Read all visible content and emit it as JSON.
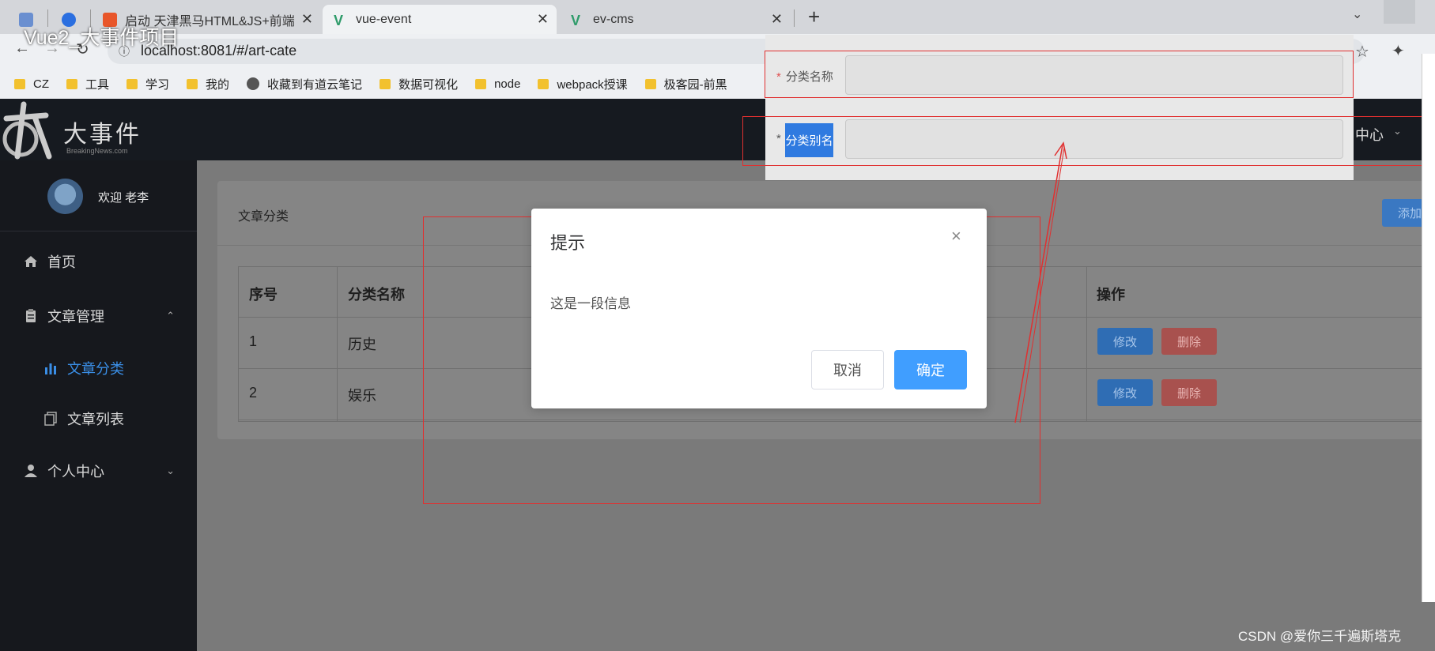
{
  "overlay_title": "Vue2_大事件项目",
  "browser": {
    "tabs": [
      {
        "label": ""
      },
      {
        "label": ""
      },
      {
        "label": "启动 天津黑马HTML&JS+前端"
      },
      {
        "label": "vue-event"
      },
      {
        "label": "ev-cms"
      }
    ],
    "new_tab": "+",
    "url": "localhost:8081/#/art-cate",
    "bookmarks": [
      "CZ",
      "工具",
      "学习",
      "我的",
      "收藏到有道云笔记",
      "数据可视化",
      "node",
      "webpack授课",
      "极客园-前黑"
    ]
  },
  "app": {
    "logo_title": "大事件",
    "logo_sub": "BreakingNews.com",
    "header_right": "中心",
    "welcome": "欢迎 老李",
    "menu": [
      {
        "label": "首页"
      },
      {
        "label": "文章管理"
      },
      {
        "label": "文章分类"
      },
      {
        "label": "文章列表"
      },
      {
        "label": "个人中心"
      }
    ]
  },
  "card": {
    "title": "文章分类",
    "add_button": "添加",
    "columns": [
      "序号",
      "分类名称",
      "操作"
    ],
    "rows": [
      {
        "index": "1",
        "name": "历史",
        "edit": "修改",
        "delete": "删除"
      },
      {
        "index": "2",
        "name": "娱乐",
        "edit": "修改",
        "delete": "删除"
      }
    ]
  },
  "form": {
    "name_label": "分类名称",
    "alias_label": "分类别名",
    "required_mark": "*"
  },
  "dialog": {
    "title": "提示",
    "message": "这是一段信息",
    "cancel": "取消",
    "confirm": "确定",
    "close": "×"
  },
  "watermark": "CSDN @爱你三千遍斯塔克",
  "colors": {
    "primary": "#409eff",
    "header_bg": "#161a20",
    "annotation_red": "#e03030"
  }
}
